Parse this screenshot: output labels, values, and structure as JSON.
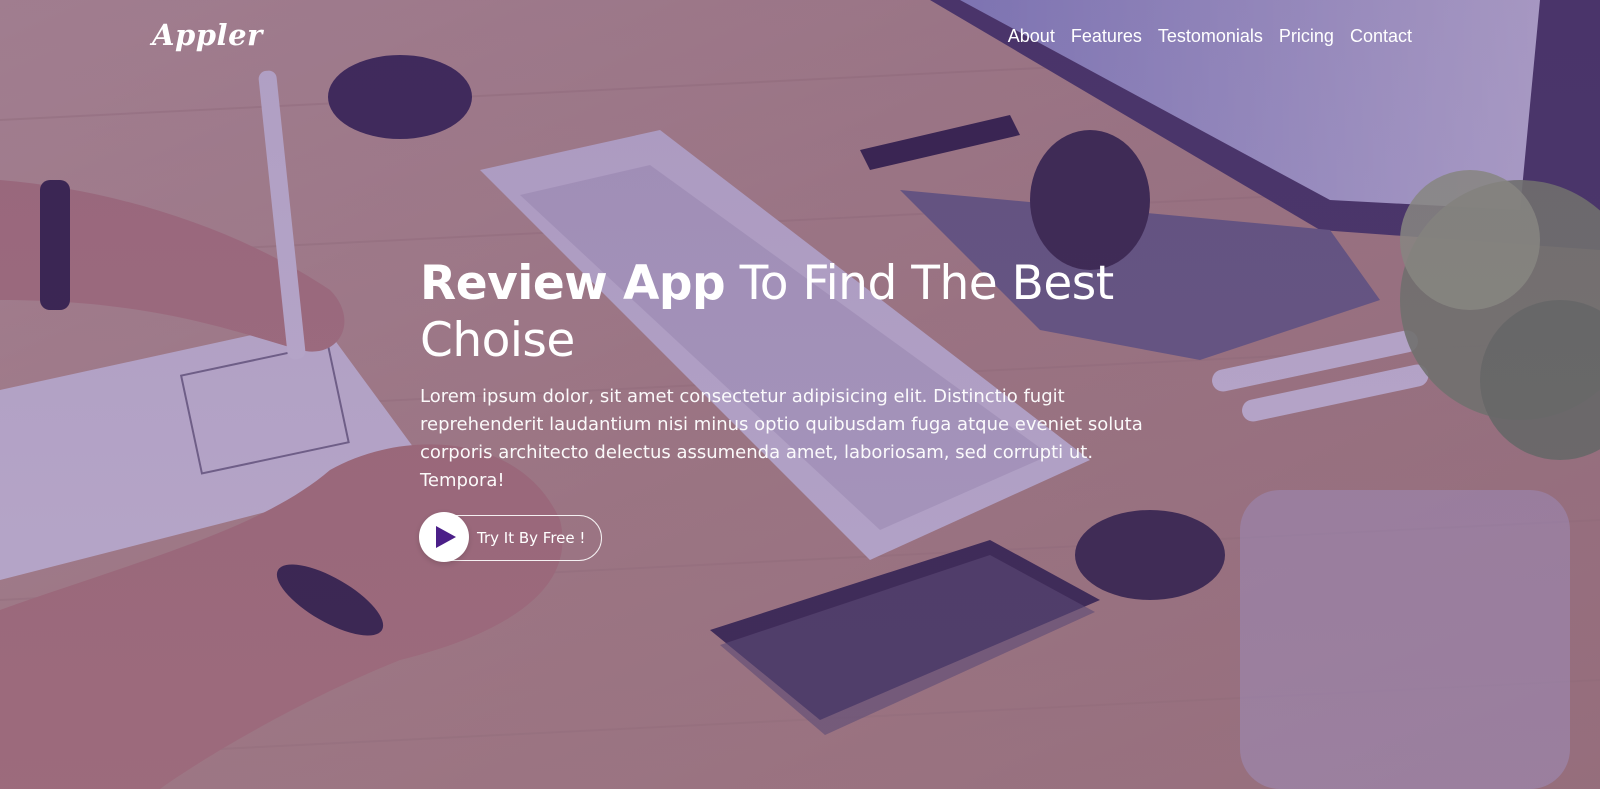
{
  "brand": {
    "name": "Appler"
  },
  "nav": {
    "items": [
      {
        "label": "About"
      },
      {
        "label": "Features"
      },
      {
        "label": "Testomonials"
      },
      {
        "label": "Pricing"
      },
      {
        "label": "Contact"
      }
    ]
  },
  "hero": {
    "headline_strong": "Review App",
    "headline_light": " To Find The Best Choise",
    "description": "Lorem ipsum dolor, sit amet consectetur adipisicing elit. Distinctio fugit reprehenderit laudantium nisi minus optio quibusdam fuga atque eveniet soluta corporis architecto delectus assumenda amet, laboriosam, sed corrupti ut. Tempora!",
    "cta_label": "Try It By Free !",
    "cta_icon": "play-icon"
  },
  "colors": {
    "overlay": "#5e3a86",
    "play_icon": "#4b1f88",
    "text": "#ffffff"
  }
}
